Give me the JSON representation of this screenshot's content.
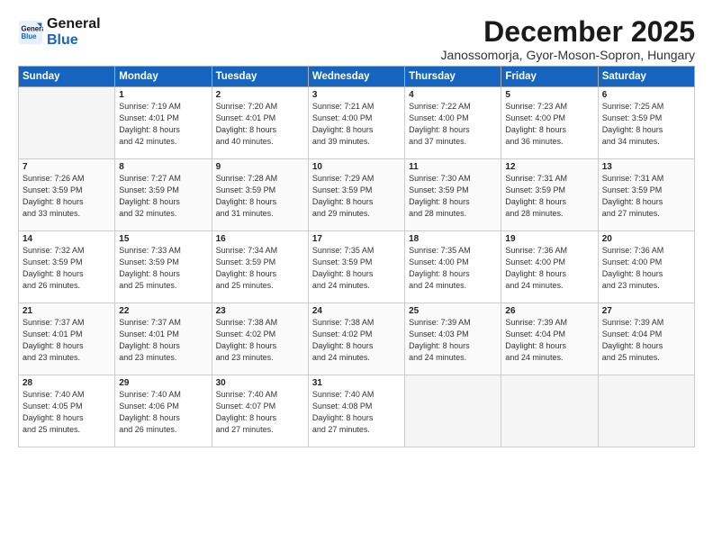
{
  "logo": {
    "line1": "General",
    "line2": "Blue"
  },
  "title": "December 2025",
  "location": "Janossomorja, Gyor-Moson-Sopron, Hungary",
  "weekdays": [
    "Sunday",
    "Monday",
    "Tuesday",
    "Wednesday",
    "Thursday",
    "Friday",
    "Saturday"
  ],
  "weeks": [
    [
      {
        "num": "",
        "info": ""
      },
      {
        "num": "1",
        "info": "Sunrise: 7:19 AM\nSunset: 4:01 PM\nDaylight: 8 hours\nand 42 minutes."
      },
      {
        "num": "2",
        "info": "Sunrise: 7:20 AM\nSunset: 4:01 PM\nDaylight: 8 hours\nand 40 minutes."
      },
      {
        "num": "3",
        "info": "Sunrise: 7:21 AM\nSunset: 4:00 PM\nDaylight: 8 hours\nand 39 minutes."
      },
      {
        "num": "4",
        "info": "Sunrise: 7:22 AM\nSunset: 4:00 PM\nDaylight: 8 hours\nand 37 minutes."
      },
      {
        "num": "5",
        "info": "Sunrise: 7:23 AM\nSunset: 4:00 PM\nDaylight: 8 hours\nand 36 minutes."
      },
      {
        "num": "6",
        "info": "Sunrise: 7:25 AM\nSunset: 3:59 PM\nDaylight: 8 hours\nand 34 minutes."
      }
    ],
    [
      {
        "num": "7",
        "info": "Sunrise: 7:26 AM\nSunset: 3:59 PM\nDaylight: 8 hours\nand 33 minutes."
      },
      {
        "num": "8",
        "info": "Sunrise: 7:27 AM\nSunset: 3:59 PM\nDaylight: 8 hours\nand 32 minutes."
      },
      {
        "num": "9",
        "info": "Sunrise: 7:28 AM\nSunset: 3:59 PM\nDaylight: 8 hours\nand 31 minutes."
      },
      {
        "num": "10",
        "info": "Sunrise: 7:29 AM\nSunset: 3:59 PM\nDaylight: 8 hours\nand 29 minutes."
      },
      {
        "num": "11",
        "info": "Sunrise: 7:30 AM\nSunset: 3:59 PM\nDaylight: 8 hours\nand 28 minutes."
      },
      {
        "num": "12",
        "info": "Sunrise: 7:31 AM\nSunset: 3:59 PM\nDaylight: 8 hours\nand 28 minutes."
      },
      {
        "num": "13",
        "info": "Sunrise: 7:31 AM\nSunset: 3:59 PM\nDaylight: 8 hours\nand 27 minutes."
      }
    ],
    [
      {
        "num": "14",
        "info": "Sunrise: 7:32 AM\nSunset: 3:59 PM\nDaylight: 8 hours\nand 26 minutes."
      },
      {
        "num": "15",
        "info": "Sunrise: 7:33 AM\nSunset: 3:59 PM\nDaylight: 8 hours\nand 25 minutes."
      },
      {
        "num": "16",
        "info": "Sunrise: 7:34 AM\nSunset: 3:59 PM\nDaylight: 8 hours\nand 25 minutes."
      },
      {
        "num": "17",
        "info": "Sunrise: 7:35 AM\nSunset: 3:59 PM\nDaylight: 8 hours\nand 24 minutes."
      },
      {
        "num": "18",
        "info": "Sunrise: 7:35 AM\nSunset: 4:00 PM\nDaylight: 8 hours\nand 24 minutes."
      },
      {
        "num": "19",
        "info": "Sunrise: 7:36 AM\nSunset: 4:00 PM\nDaylight: 8 hours\nand 24 minutes."
      },
      {
        "num": "20",
        "info": "Sunrise: 7:36 AM\nSunset: 4:00 PM\nDaylight: 8 hours\nand 23 minutes."
      }
    ],
    [
      {
        "num": "21",
        "info": "Sunrise: 7:37 AM\nSunset: 4:01 PM\nDaylight: 8 hours\nand 23 minutes."
      },
      {
        "num": "22",
        "info": "Sunrise: 7:37 AM\nSunset: 4:01 PM\nDaylight: 8 hours\nand 23 minutes."
      },
      {
        "num": "23",
        "info": "Sunrise: 7:38 AM\nSunset: 4:02 PM\nDaylight: 8 hours\nand 23 minutes."
      },
      {
        "num": "24",
        "info": "Sunrise: 7:38 AM\nSunset: 4:02 PM\nDaylight: 8 hours\nand 24 minutes."
      },
      {
        "num": "25",
        "info": "Sunrise: 7:39 AM\nSunset: 4:03 PM\nDaylight: 8 hours\nand 24 minutes."
      },
      {
        "num": "26",
        "info": "Sunrise: 7:39 AM\nSunset: 4:04 PM\nDaylight: 8 hours\nand 24 minutes."
      },
      {
        "num": "27",
        "info": "Sunrise: 7:39 AM\nSunset: 4:04 PM\nDaylight: 8 hours\nand 25 minutes."
      }
    ],
    [
      {
        "num": "28",
        "info": "Sunrise: 7:40 AM\nSunset: 4:05 PM\nDaylight: 8 hours\nand 25 minutes."
      },
      {
        "num": "29",
        "info": "Sunrise: 7:40 AM\nSunset: 4:06 PM\nDaylight: 8 hours\nand 26 minutes."
      },
      {
        "num": "30",
        "info": "Sunrise: 7:40 AM\nSunset: 4:07 PM\nDaylight: 8 hours\nand 27 minutes."
      },
      {
        "num": "31",
        "info": "Sunrise: 7:40 AM\nSunset: 4:08 PM\nDaylight: 8 hours\nand 27 minutes."
      },
      {
        "num": "",
        "info": ""
      },
      {
        "num": "",
        "info": ""
      },
      {
        "num": "",
        "info": ""
      }
    ]
  ]
}
